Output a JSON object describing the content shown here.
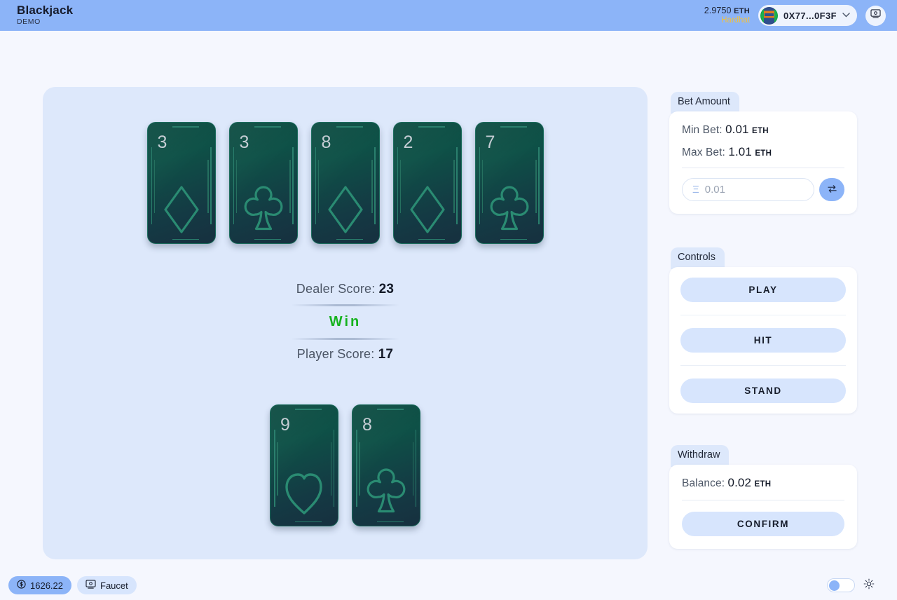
{
  "header": {
    "title": "Blackjack",
    "subtitle": "DEMO",
    "balance_amount": "2.9750",
    "balance_unit": "ETH",
    "network": "Hardhat",
    "account": "0X77...0F3F",
    "chevron": "▾",
    "screen_icon": "screen-icon"
  },
  "board": {
    "dealer_cards": [
      {
        "rank": "3",
        "suit": "diamond"
      },
      {
        "rank": "3",
        "suit": "club"
      },
      {
        "rank": "8",
        "suit": "diamond"
      },
      {
        "rank": "2",
        "suit": "diamond"
      },
      {
        "rank": "7",
        "suit": "club"
      }
    ],
    "player_cards": [
      {
        "rank": "9",
        "suit": "heart"
      },
      {
        "rank": "8",
        "suit": "club"
      }
    ],
    "dealer_score_label": "Dealer Score:",
    "dealer_score_value": "23",
    "player_score_label": "Player Score:",
    "player_score_value": "17",
    "result": "Win",
    "result_color": "#16b21e"
  },
  "bet_panel": {
    "tab": "Bet Amount",
    "min_label": "Min Bet:",
    "min_value": "0.01",
    "min_unit": "ETH",
    "max_label": "Max Bet:",
    "max_value": "1.01",
    "max_unit": "ETH",
    "input_symbol": "Ξ",
    "input_placeholder": "0.01",
    "input_value": "",
    "swap_icon": "swap-arrows-icon"
  },
  "controls_panel": {
    "tab": "Controls",
    "play": "PLAY",
    "hit": "HIT",
    "stand": "STAND"
  },
  "withdraw_panel": {
    "tab": "Withdraw",
    "balance_label": "Balance:",
    "balance_value": "0.02",
    "balance_unit": "ETH",
    "confirm": "CONFIRM"
  },
  "footer": {
    "price": "1626.22",
    "price_icon": "dollar-circle-icon",
    "faucet": "Faucet",
    "faucet_icon": "screen-icon",
    "theme_toggle": "theme-toggle",
    "theme_icon": "sun-icon"
  },
  "colors": {
    "accent": "#8cb4f8",
    "board": "#dde8fb",
    "page_bg": "#f5f7fe",
    "card_green": "#0e5147",
    "win_green": "#16b21e",
    "network_yellow": "#f0c040"
  }
}
